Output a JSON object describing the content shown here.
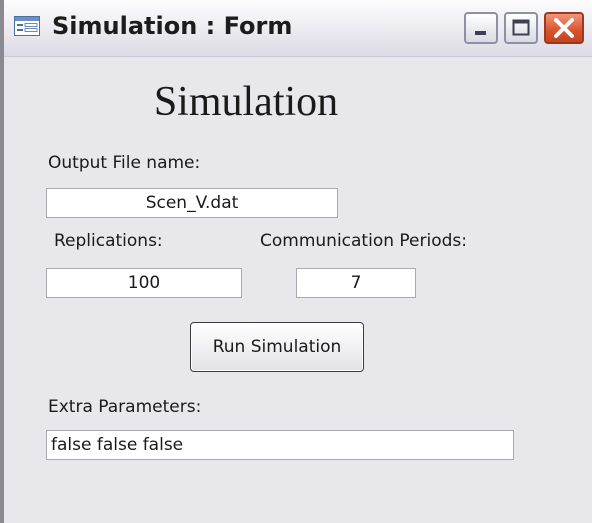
{
  "window": {
    "title": "Simulation : Form"
  },
  "icons": {
    "app": "form-view-icon",
    "minimize": "minimize-icon",
    "maximize": "maximize-icon",
    "close": "close-icon"
  },
  "form": {
    "heading": "Simulation",
    "output_file_label": "Output File name:",
    "output_file_value": "Scen_V.dat",
    "replications_label": "Replications:",
    "replications_value": "100",
    "communication_periods_label": "Communication Periods:",
    "communication_periods_value": "7",
    "run_button_label": "Run Simulation",
    "extra_parameters_label": "Extra Parameters:",
    "extra_parameters_value": "false false false"
  },
  "colors": {
    "close_button": "#d8532d",
    "form_background": "#e8e7ec"
  }
}
